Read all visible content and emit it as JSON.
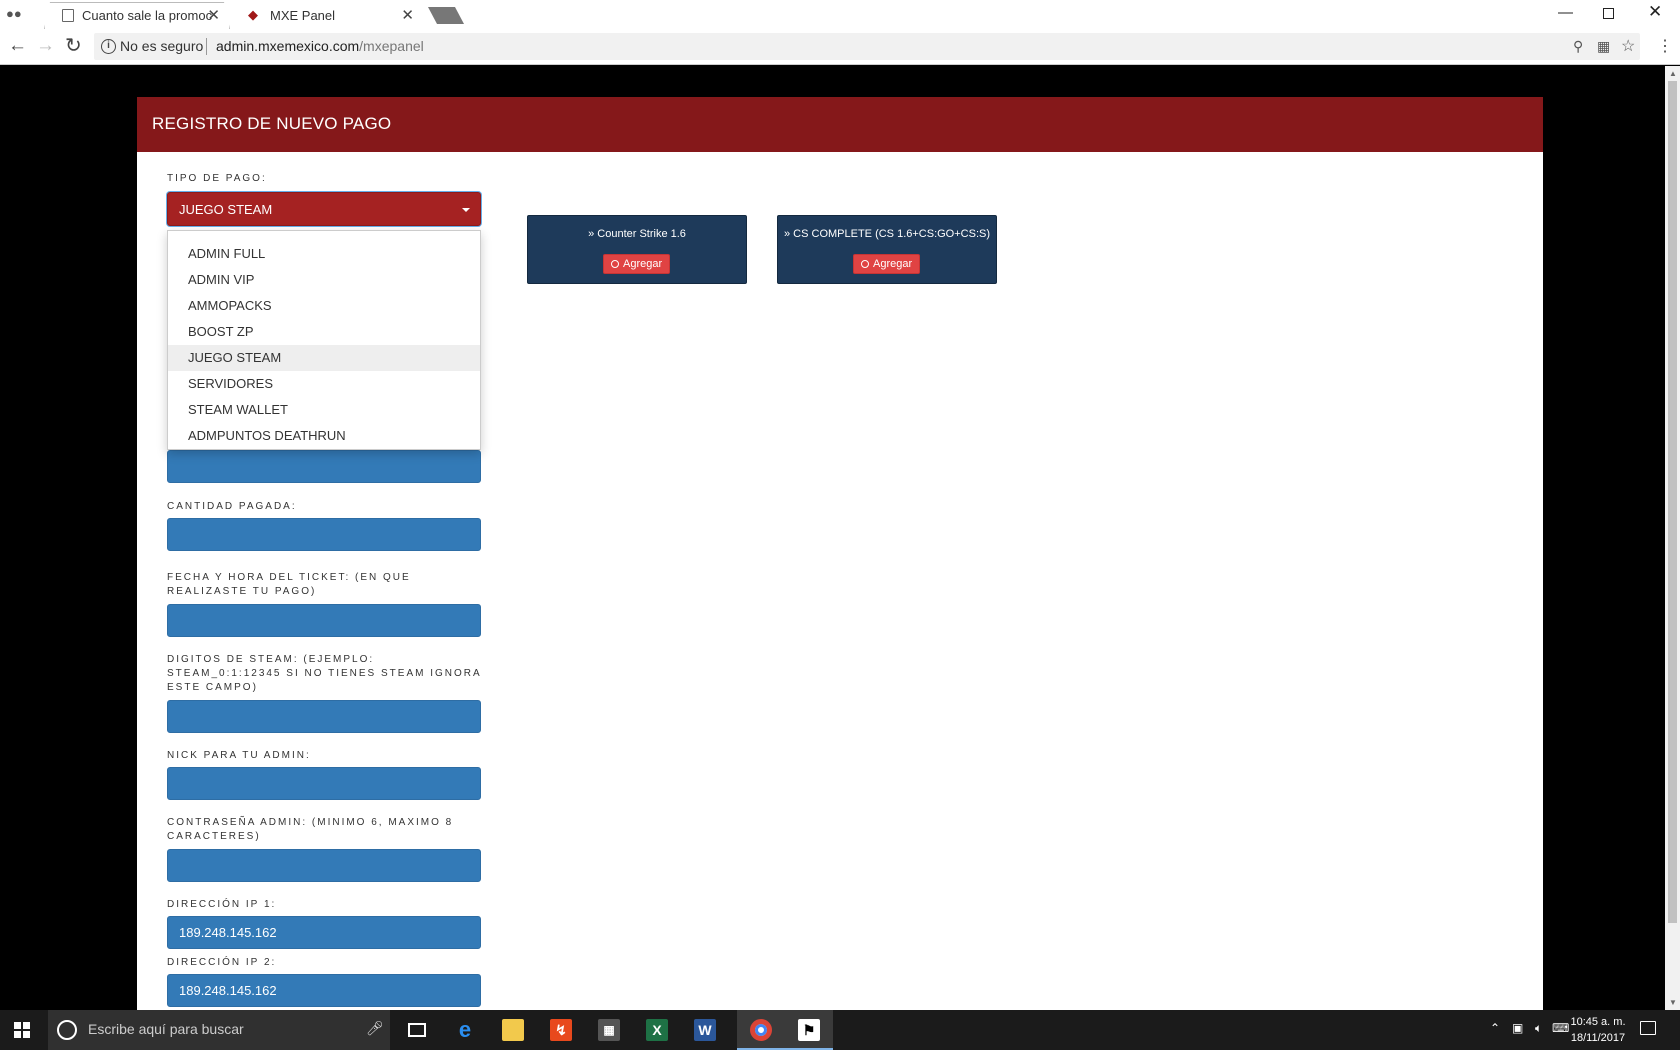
{
  "browser": {
    "tabs": [
      {
        "title": "Cuanto sale la promocio",
        "active": false
      },
      {
        "title": "MXE Panel",
        "active": true
      }
    ],
    "omnibox": {
      "security_label": "No es seguro",
      "url_host": "admin.mxemexico.com",
      "url_path": "/mxepanel"
    }
  },
  "page": {
    "header_title": "REGISTRO DE NUEVO PAGO",
    "tipo_label": "TIPO DE PAGO:",
    "tipo_selected": "JUEGO STEAM",
    "dropdown_options": [
      {
        "label": "ADMIN FULL",
        "hovered": false
      },
      {
        "label": "ADMIN VIP",
        "hovered": false
      },
      {
        "label": "AMMOPACKS",
        "hovered": false
      },
      {
        "label": "BOOST ZP",
        "hovered": false
      },
      {
        "label": "JUEGO STEAM",
        "hovered": true
      },
      {
        "label": "SERVIDORES",
        "hovered": false
      },
      {
        "label": "STEAM WALLET",
        "hovered": false
      },
      {
        "label": "ADMPUNTOS DEATHRUN",
        "hovered": false
      }
    ],
    "fields": {
      "cantidad_label": "CANTIDAD PAGADA:",
      "cantidad_value": "",
      "fecha_label": "FECHA Y HORA DEL TICKET: (EN QUE REALIZASTE TU PAGO)",
      "fecha_value": "",
      "steam_label": "DIGITOS DE STEAM: (EJEMPLO: STEAM_0:1:12345 SI NO TIENES STEAM IGNORA ESTE CAMPO)",
      "steam_value": "",
      "nick_label": "NICK PARA TU ADMIN:",
      "nick_value": "",
      "pass_label": "CONTRASEÑA ADMIN: (MINIMO 6, MAXIMO 8 CARACTERES)",
      "pass_value": "",
      "ip1_label": "DIRECCIÓN IP 1:",
      "ip1_value": "189.248.145.162",
      "ip2_label": "DIRECCIÓN IP 2:",
      "ip2_value": "189.248.145.162"
    },
    "products": [
      {
        "title": "Counter Strike 1.6",
        "button": "Agregar"
      },
      {
        "title": "CS COMPLETE (CS 1.6+CS:GO+CS:S)",
        "button": "Agregar"
      }
    ]
  },
  "taskbar": {
    "search_placeholder": "Escribe aquí para buscar",
    "time": "10:45 a. m.",
    "date": "18/11/2017",
    "apps": [
      "task-view",
      "edge",
      "file-explorer",
      "pdf-reader",
      "calculator",
      "excel",
      "word",
      "chrome",
      "counter-strike"
    ]
  },
  "colors": {
    "header_red": "#85181a",
    "select_red": "#a52222",
    "input_blue": "#337ab7",
    "card_navy": "#1e3a5a",
    "button_red": "#e04343"
  }
}
